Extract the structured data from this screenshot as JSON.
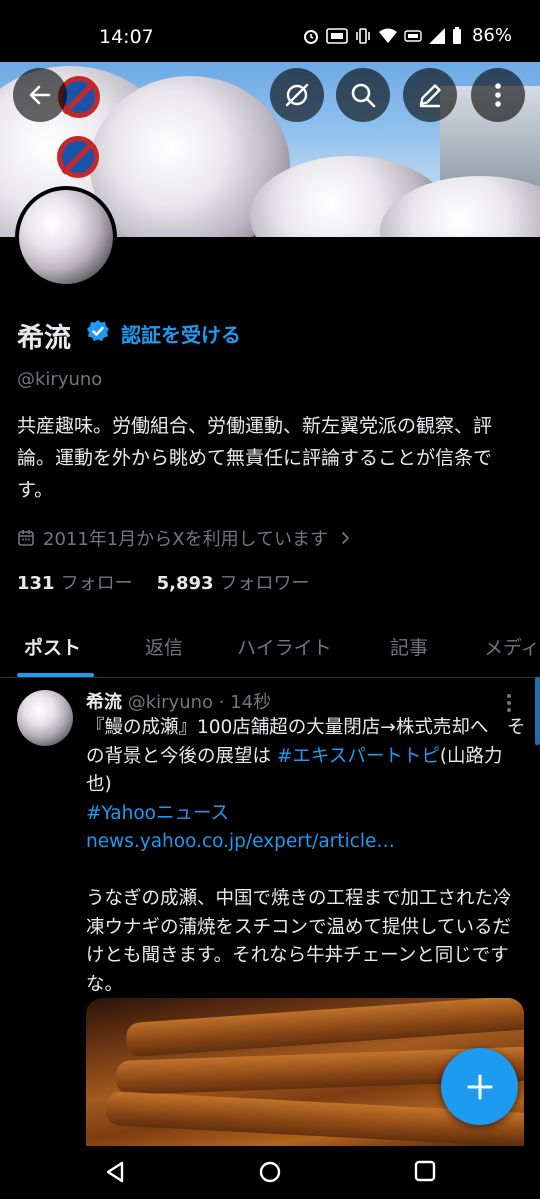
{
  "status_bar": {
    "time": "14:07",
    "battery": "86%"
  },
  "profile": {
    "name": "希流",
    "verify_link": "認証を受ける",
    "handle": "@kiryuno",
    "bio": "共産趣味。労働組合、労働運動、新左翼党派の観察、評論。運動を外から眺めて無責任に評論することが信条です。",
    "joined": "2011年1月からXを利用しています",
    "following_count": "131",
    "following_label": "フォロー",
    "followers_count": "5,893",
    "followers_label": "フォロワー"
  },
  "tabs": [
    "ポスト",
    "返信",
    "ハイライト",
    "記事",
    "メディア"
  ],
  "post": {
    "author": "希流",
    "handle": "@kiryuno",
    "separator": "·",
    "time": "14秒",
    "line1": "『鰻の成瀬』100店舗超の大量閉店→株式売却へ　その背景と今後の展望は ",
    "hashtag1": "#エキスパートトピ",
    "line1_tail": "(山路力也)",
    "hashtag2": "#Yahooニュース",
    "url": "news.yahoo.co.jp/expert/article…",
    "body": "うなぎの成瀬、中国で焼きの工程まで加工された冷凍ウナギの蒲焼をスチコンで温めて提供しているだけとも聞きます。それなら牛丼チェーンと同じですな。"
  },
  "colors": {
    "accent": "#1d9bf0",
    "background": "#000000",
    "muted": "#71767b",
    "text": "#e7e9ea"
  },
  "icons": [
    "back-arrow-icon",
    "grok-icon",
    "search-icon",
    "edit-icon",
    "more-vertical-icon",
    "verified-badge-icon",
    "calendar-icon",
    "chevron-right-icon",
    "plus-icon",
    "nav-back-icon",
    "nav-home-icon",
    "nav-recents-icon"
  ]
}
